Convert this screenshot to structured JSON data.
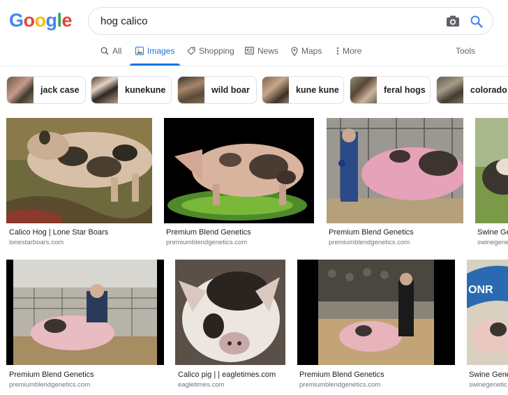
{
  "logo": {
    "letters": [
      "G",
      "o",
      "o",
      "g",
      "l",
      "e"
    ],
    "colors": [
      "#4285F4",
      "#EA4335",
      "#FBBC05",
      "#4285F4",
      "#34A853",
      "#EA4335"
    ]
  },
  "search": {
    "query": "hog calico"
  },
  "tabs": {
    "all": "All",
    "images": "Images",
    "shopping": "Shopping",
    "news": "News",
    "maps": "Maps",
    "more": "More",
    "tools": "Tools"
  },
  "chips": [
    "jack case",
    "kunekune",
    "wild boar",
    "kune kune",
    "feral hogs",
    "colorado"
  ],
  "results": [
    {
      "title": "Calico Hog | Lone Star Boars",
      "source": "lonestarboars.com"
    },
    {
      "title": "Premium Blend Genetics",
      "source": "premiumblendgenetics.com"
    },
    {
      "title": "Premium Blend Genetics",
      "source": "premiumblendgenetics.com"
    },
    {
      "title": "Swine Ge",
      "source": "swinegene"
    },
    {
      "title": "Premium Blend Genetics",
      "source": "premiumblendgenetics.com"
    },
    {
      "title": "Calico pig | | eagletimes.com",
      "source": "eagletimes.com"
    },
    {
      "title": "Premium Blend Genetics",
      "source": "premiumblendgenetics.com"
    },
    {
      "title": "Swine Genet",
      "source": "swinegenetic"
    }
  ],
  "colors": {
    "accent": "#1a73e8",
    "muted": "#5f6368",
    "border": "#dfe1e5"
  }
}
